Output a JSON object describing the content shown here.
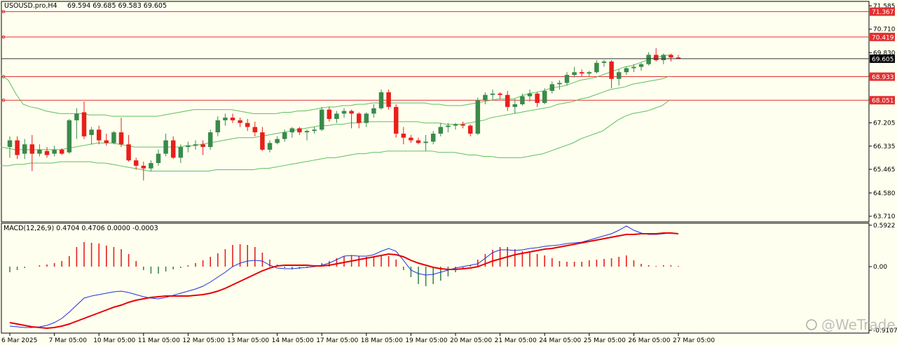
{
  "chart_data": {
    "type": "candlestick",
    "symbol_info": "USOUSD.pro,H4",
    "ohlc_info": "69.594 69.685 69.583 69.605",
    "colors": {
      "background": "#fffff0",
      "bull": "#3a8a4a",
      "bear": "#e8201a",
      "bands": "#5cc05c",
      "macd_line": "#2030e0",
      "signal_line": "#e80000",
      "level": "#e03030"
    },
    "price_axis": {
      "ticks": [
        "71.585",
        "70.710",
        "69.830",
        "68.960",
        "68.075",
        "67.205",
        "66.335",
        "65.465",
        "64.580",
        "63.710"
      ],
      "ylim": [
        63.5,
        71.75
      ]
    },
    "levels": [
      {
        "value": 71.367,
        "label": "71.367"
      },
      {
        "value": 70.419,
        "label": "70.419"
      },
      {
        "value": 68.933,
        "label": "68.933"
      },
      {
        "value": 68.051,
        "label": "68.051"
      }
    ],
    "current_price": {
      "value": 69.605,
      "label": "69.605"
    },
    "candles": [
      {
        "o": 66.3,
        "h": 66.7,
        "l": 65.9,
        "c": 66.55
      },
      {
        "o": 66.55,
        "h": 66.7,
        "l": 65.85,
        "c": 66.0
      },
      {
        "o": 66.05,
        "h": 66.6,
        "l": 65.85,
        "c": 66.4
      },
      {
        "o": 66.4,
        "h": 66.75,
        "l": 65.4,
        "c": 66.05
      },
      {
        "o": 66.05,
        "h": 66.4,
        "l": 65.95,
        "c": 66.2
      },
      {
        "o": 66.15,
        "h": 66.3,
        "l": 65.9,
        "c": 66.0
      },
      {
        "o": 66.05,
        "h": 66.35,
        "l": 65.95,
        "c": 66.2
      },
      {
        "o": 66.2,
        "h": 66.25,
        "l": 66.0,
        "c": 66.05
      },
      {
        "o": 66.1,
        "h": 67.35,
        "l": 66.05,
        "c": 67.3
      },
      {
        "o": 67.3,
        "h": 67.75,
        "l": 66.6,
        "c": 67.55
      },
      {
        "o": 67.6,
        "h": 68.0,
        "l": 66.6,
        "c": 66.7
      },
      {
        "o": 66.75,
        "h": 67.05,
        "l": 66.4,
        "c": 66.95
      },
      {
        "o": 66.95,
        "h": 67.1,
        "l": 66.4,
        "c": 66.55
      },
      {
        "o": 66.55,
        "h": 66.8,
        "l": 66.35,
        "c": 66.45
      },
      {
        "o": 66.45,
        "h": 66.9,
        "l": 66.4,
        "c": 66.85
      },
      {
        "o": 66.85,
        "h": 67.4,
        "l": 66.3,
        "c": 66.4
      },
      {
        "o": 66.4,
        "h": 66.75,
        "l": 65.75,
        "c": 65.8
      },
      {
        "o": 65.8,
        "h": 65.9,
        "l": 65.45,
        "c": 65.6
      },
      {
        "o": 65.6,
        "h": 65.75,
        "l": 65.05,
        "c": 65.5
      },
      {
        "o": 65.5,
        "h": 65.8,
        "l": 65.4,
        "c": 65.7
      },
      {
        "o": 65.7,
        "h": 66.2,
        "l": 65.6,
        "c": 66.05
      },
      {
        "o": 66.05,
        "h": 66.8,
        "l": 65.95,
        "c": 66.55
      },
      {
        "o": 66.55,
        "h": 66.7,
        "l": 65.85,
        "c": 65.9
      },
      {
        "o": 65.9,
        "h": 66.4,
        "l": 65.7,
        "c": 66.3
      },
      {
        "o": 66.3,
        "h": 66.5,
        "l": 66.1,
        "c": 66.35
      },
      {
        "o": 66.35,
        "h": 66.55,
        "l": 66.2,
        "c": 66.4
      },
      {
        "o": 66.4,
        "h": 66.55,
        "l": 66.0,
        "c": 66.3
      },
      {
        "o": 66.3,
        "h": 66.95,
        "l": 66.2,
        "c": 66.85
      },
      {
        "o": 66.85,
        "h": 67.45,
        "l": 66.7,
        "c": 67.3
      },
      {
        "o": 67.3,
        "h": 67.55,
        "l": 67.1,
        "c": 67.4
      },
      {
        "o": 67.4,
        "h": 67.55,
        "l": 67.2,
        "c": 67.3
      },
      {
        "o": 67.3,
        "h": 67.4,
        "l": 67.05,
        "c": 67.2
      },
      {
        "o": 67.2,
        "h": 67.35,
        "l": 66.9,
        "c": 67.05
      },
      {
        "o": 67.05,
        "h": 67.25,
        "l": 66.7,
        "c": 66.85
      },
      {
        "o": 66.85,
        "h": 67.05,
        "l": 66.15,
        "c": 66.2
      },
      {
        "o": 66.2,
        "h": 66.55,
        "l": 66.1,
        "c": 66.45
      },
      {
        "o": 66.45,
        "h": 66.7,
        "l": 66.4,
        "c": 66.6
      },
      {
        "o": 66.6,
        "h": 66.95,
        "l": 66.5,
        "c": 66.85
      },
      {
        "o": 66.85,
        "h": 67.05,
        "l": 66.65,
        "c": 67.0
      },
      {
        "o": 67.0,
        "h": 67.05,
        "l": 66.75,
        "c": 66.85
      },
      {
        "o": 66.85,
        "h": 66.95,
        "l": 66.55,
        "c": 66.9
      },
      {
        "o": 66.9,
        "h": 67.05,
        "l": 66.8,
        "c": 66.95
      },
      {
        "o": 66.95,
        "h": 67.8,
        "l": 66.9,
        "c": 67.7
      },
      {
        "o": 67.7,
        "h": 67.8,
        "l": 67.25,
        "c": 67.35
      },
      {
        "o": 67.35,
        "h": 67.65,
        "l": 67.2,
        "c": 67.55
      },
      {
        "o": 67.55,
        "h": 67.75,
        "l": 67.4,
        "c": 67.65
      },
      {
        "o": 67.65,
        "h": 67.7,
        "l": 67.0,
        "c": 67.55
      },
      {
        "o": 67.55,
        "h": 67.6,
        "l": 67.0,
        "c": 67.2
      },
      {
        "o": 67.2,
        "h": 67.6,
        "l": 67.05,
        "c": 67.55
      },
      {
        "o": 67.55,
        "h": 67.9,
        "l": 67.4,
        "c": 67.75
      },
      {
        "o": 67.75,
        "h": 68.45,
        "l": 67.7,
        "c": 68.35
      },
      {
        "o": 68.35,
        "h": 68.45,
        "l": 67.7,
        "c": 67.8
      },
      {
        "o": 67.8,
        "h": 67.9,
        "l": 66.65,
        "c": 66.8
      },
      {
        "o": 66.8,
        "h": 67.05,
        "l": 66.4,
        "c": 66.65
      },
      {
        "o": 66.65,
        "h": 66.75,
        "l": 66.45,
        "c": 66.55
      },
      {
        "o": 66.55,
        "h": 66.65,
        "l": 66.4,
        "c": 66.45
      },
      {
        "o": 66.45,
        "h": 66.75,
        "l": 66.15,
        "c": 66.5
      },
      {
        "o": 66.5,
        "h": 66.9,
        "l": 66.4,
        "c": 66.8
      },
      {
        "o": 66.8,
        "h": 67.2,
        "l": 66.7,
        "c": 67.05
      },
      {
        "o": 67.05,
        "h": 67.2,
        "l": 66.85,
        "c": 67.1
      },
      {
        "o": 67.1,
        "h": 67.2,
        "l": 66.95,
        "c": 67.15
      },
      {
        "o": 67.15,
        "h": 67.25,
        "l": 67.0,
        "c": 67.1
      },
      {
        "o": 67.1,
        "h": 67.15,
        "l": 66.7,
        "c": 66.8
      },
      {
        "o": 66.8,
        "h": 68.15,
        "l": 66.75,
        "c": 68.05
      },
      {
        "o": 68.05,
        "h": 68.35,
        "l": 67.9,
        "c": 68.25
      },
      {
        "o": 68.25,
        "h": 68.45,
        "l": 68.05,
        "c": 68.3
      },
      {
        "o": 68.3,
        "h": 68.35,
        "l": 68.1,
        "c": 68.25
      },
      {
        "o": 68.25,
        "h": 68.4,
        "l": 67.65,
        "c": 67.8
      },
      {
        "o": 67.8,
        "h": 68.1,
        "l": 67.55,
        "c": 67.9
      },
      {
        "o": 67.9,
        "h": 68.3,
        "l": 67.85,
        "c": 68.2
      },
      {
        "o": 68.2,
        "h": 68.45,
        "l": 68.0,
        "c": 68.3
      },
      {
        "o": 68.3,
        "h": 68.35,
        "l": 67.8,
        "c": 67.95
      },
      {
        "o": 67.95,
        "h": 68.5,
        "l": 67.9,
        "c": 68.4
      },
      {
        "o": 68.4,
        "h": 68.75,
        "l": 68.3,
        "c": 68.65
      },
      {
        "o": 68.65,
        "h": 68.8,
        "l": 68.45,
        "c": 68.7
      },
      {
        "o": 68.7,
        "h": 69.1,
        "l": 68.6,
        "c": 69.0
      },
      {
        "o": 69.0,
        "h": 69.3,
        "l": 68.9,
        "c": 69.1
      },
      {
        "o": 69.1,
        "h": 69.2,
        "l": 68.95,
        "c": 69.05
      },
      {
        "o": 69.05,
        "h": 69.15,
        "l": 68.95,
        "c": 69.1
      },
      {
        "o": 69.1,
        "h": 69.55,
        "l": 69.05,
        "c": 69.45
      },
      {
        "o": 69.45,
        "h": 69.55,
        "l": 69.3,
        "c": 69.5
      },
      {
        "o": 69.5,
        "h": 69.55,
        "l": 68.5,
        "c": 68.85
      },
      {
        "o": 68.85,
        "h": 69.2,
        "l": 68.6,
        "c": 69.1
      },
      {
        "o": 69.1,
        "h": 69.3,
        "l": 69.0,
        "c": 69.25
      },
      {
        "o": 69.25,
        "h": 69.4,
        "l": 69.1,
        "c": 69.3
      },
      {
        "o": 69.3,
        "h": 69.45,
        "l": 69.15,
        "c": 69.4
      },
      {
        "o": 69.4,
        "h": 69.85,
        "l": 69.35,
        "c": 69.75
      },
      {
        "o": 69.75,
        "h": 70.0,
        "l": 69.5,
        "c": 69.55
      },
      {
        "o": 69.55,
        "h": 69.8,
        "l": 69.4,
        "c": 69.75
      },
      {
        "o": 69.75,
        "h": 69.8,
        "l": 69.5,
        "c": 69.65
      },
      {
        "o": 69.65,
        "h": 69.75,
        "l": 69.6,
        "c": 69.6
      }
    ],
    "bollinger": {
      "upper": [
        69.0,
        68.8,
        68.3,
        67.9,
        67.8,
        67.75,
        67.65,
        67.6,
        67.55,
        67.55,
        67.55,
        67.55,
        67.5,
        67.5,
        67.5,
        67.45,
        67.45,
        67.45,
        67.45,
        67.45,
        67.45,
        67.45,
        67.5,
        67.55,
        67.6,
        67.65,
        67.7,
        67.7,
        67.7,
        67.7,
        67.7,
        67.7,
        67.65,
        67.6,
        67.55,
        67.55,
        67.55,
        67.55,
        67.6,
        67.6,
        67.65,
        67.65,
        67.7,
        67.75,
        67.8,
        67.8,
        67.85,
        67.85,
        67.9,
        67.9,
        67.95,
        67.95,
        67.95,
        67.95,
        67.95,
        67.95,
        67.95,
        67.95,
        67.9,
        67.9,
        67.85,
        67.85,
        67.85,
        67.9,
        67.95,
        68.0,
        68.05,
        68.1,
        68.1,
        68.1,
        68.2,
        68.3,
        68.35,
        68.4,
        68.5,
        68.55,
        68.6,
        68.7,
        68.8,
        68.85,
        68.9,
        69.0,
        69.1,
        69.2,
        69.3,
        69.35,
        69.45,
        69.55,
        69.65,
        69.7,
        69.75
      ],
      "middle": [
        66.3,
        66.25,
        66.2,
        66.2,
        66.2,
        66.2,
        66.2,
        66.2,
        66.2,
        66.25,
        66.3,
        66.35,
        66.4,
        66.45,
        66.45,
        66.45,
        66.4,
        66.35,
        66.3,
        66.3,
        66.3,
        66.3,
        66.3,
        66.3,
        66.3,
        66.35,
        66.35,
        66.4,
        66.45,
        66.5,
        66.55,
        66.6,
        66.65,
        66.65,
        66.65,
        66.7,
        66.75,
        66.8,
        66.85,
        66.9,
        66.95,
        67.0,
        67.05,
        67.1,
        67.1,
        67.15,
        67.15,
        67.2,
        67.2,
        67.25,
        67.25,
        67.25,
        67.25,
        67.25,
        67.25,
        67.25,
        67.25,
        67.2,
        67.2,
        67.2,
        67.15,
        67.15,
        67.15,
        67.2,
        67.25,
        67.3,
        67.4,
        67.45,
        67.5,
        67.55,
        67.6,
        67.65,
        67.7,
        67.75,
        67.8,
        67.9,
        67.95,
        68.0,
        68.1,
        68.15,
        68.25,
        68.35,
        68.45,
        68.5,
        68.55,
        68.65,
        68.7,
        68.75,
        68.8,
        68.85,
        68.95
      ],
      "lower": [
        65.6,
        65.6,
        65.65,
        65.65,
        65.7,
        65.7,
        65.7,
        65.7,
        65.75,
        65.75,
        65.75,
        65.75,
        65.75,
        65.7,
        65.7,
        65.65,
        65.6,
        65.55,
        65.5,
        65.45,
        65.4,
        65.4,
        65.4,
        65.4,
        65.4,
        65.4,
        65.4,
        65.4,
        65.4,
        65.45,
        65.45,
        65.45,
        65.45,
        65.45,
        65.45,
        65.5,
        65.5,
        65.55,
        65.6,
        65.65,
        65.7,
        65.75,
        65.8,
        65.85,
        65.9,
        65.9,
        65.95,
        66.0,
        66.05,
        66.05,
        66.1,
        66.1,
        66.15,
        66.15,
        66.15,
        66.15,
        66.15,
        66.15,
        66.15,
        66.1,
        66.1,
        66.1,
        66.05,
        66.0,
        66.0,
        65.95,
        65.95,
        65.9,
        65.9,
        65.9,
        65.9,
        65.95,
        66.0,
        66.05,
        66.15,
        66.25,
        66.35,
        66.45,
        66.6,
        66.7,
        66.8,
        66.9,
        67.1,
        67.3,
        67.45,
        67.55,
        67.6,
        67.65,
        67.75,
        67.85,
        68.05
      ]
    },
    "macd": {
      "info": "MACD(12,26,9) 0.4704 0.4706 0.0000 -0.0003",
      "ticks": [
        "0.5922",
        "0.00",
        "-0.9107"
      ],
      "ylim": [
        -0.95,
        0.62
      ],
      "histogram": [
        -0.08,
        -0.05,
        -0.02,
        0.0,
        0.02,
        0.03,
        0.05,
        0.08,
        0.15,
        0.28,
        0.35,
        0.34,
        0.33,
        0.3,
        0.28,
        0.25,
        0.18,
        0.08,
        -0.05,
        -0.1,
        -0.1,
        -0.07,
        -0.04,
        -0.02,
        0.02,
        0.05,
        0.09,
        0.14,
        0.19,
        0.25,
        0.31,
        0.32,
        0.31,
        0.28,
        0.2,
        0.1,
        0.03,
        -0.02,
        -0.04,
        -0.03,
        -0.02,
        0.02,
        0.05,
        0.08,
        0.12,
        0.15,
        0.16,
        0.15,
        0.14,
        0.14,
        0.15,
        0.15,
        0.1,
        -0.05,
        -0.15,
        -0.25,
        -0.28,
        -0.25,
        -0.2,
        -0.14,
        -0.08,
        -0.03,
        0.02,
        0.1,
        0.18,
        0.24,
        0.28,
        0.28,
        0.25,
        0.22,
        0.2,
        0.18,
        0.16,
        0.12,
        0.08,
        0.07,
        0.07,
        0.07,
        0.09,
        0.1,
        0.11,
        0.12,
        0.14,
        0.16,
        0.09,
        0.04,
        0.02,
        0.01,
        0.02,
        0.02,
        0.01
      ],
      "macd_line": [
        -0.85,
        -0.86,
        -0.87,
        -0.87,
        -0.86,
        -0.84,
        -0.8,
        -0.74,
        -0.65,
        -0.55,
        -0.45,
        -0.42,
        -0.4,
        -0.38,
        -0.36,
        -0.35,
        -0.37,
        -0.4,
        -0.43,
        -0.45,
        -0.46,
        -0.44,
        -0.41,
        -0.38,
        -0.35,
        -0.32,
        -0.28,
        -0.22,
        -0.15,
        -0.08,
        0.0,
        0.05,
        0.08,
        0.09,
        0.08,
        0.02,
        -0.02,
        -0.03,
        -0.03,
        -0.02,
        -0.01,
        0.0,
        0.02,
        0.05,
        0.1,
        0.15,
        0.16,
        0.15,
        0.15,
        0.17,
        0.22,
        0.26,
        0.22,
        0.09,
        -0.05,
        -0.1,
        -0.12,
        -0.11,
        -0.08,
        -0.05,
        -0.02,
        0.0,
        0.02,
        0.04,
        0.12,
        0.2,
        0.24,
        0.24,
        0.23,
        0.24,
        0.26,
        0.27,
        0.29,
        0.3,
        0.31,
        0.33,
        0.34,
        0.35,
        0.38,
        0.41,
        0.44,
        0.47,
        0.52,
        0.58,
        0.52,
        0.48,
        0.46,
        0.46,
        0.47,
        0.48,
        0.47
      ],
      "signal_line": [
        -0.8,
        -0.82,
        -0.84,
        -0.86,
        -0.87,
        -0.88,
        -0.87,
        -0.85,
        -0.82,
        -0.78,
        -0.74,
        -0.7,
        -0.66,
        -0.62,
        -0.58,
        -0.55,
        -0.51,
        -0.48,
        -0.46,
        -0.44,
        -0.43,
        -0.42,
        -0.42,
        -0.42,
        -0.42,
        -0.41,
        -0.4,
        -0.38,
        -0.35,
        -0.31,
        -0.26,
        -0.21,
        -0.16,
        -0.11,
        -0.06,
        -0.02,
        0.01,
        0.02,
        0.02,
        0.02,
        0.02,
        0.01,
        0.01,
        0.02,
        0.04,
        0.06,
        0.08,
        0.1,
        0.12,
        0.14,
        0.16,
        0.18,
        0.17,
        0.14,
        0.09,
        0.05,
        0.02,
        -0.01,
        -0.03,
        -0.04,
        -0.04,
        -0.03,
        -0.02,
        0.0,
        0.04,
        0.08,
        0.11,
        0.14,
        0.17,
        0.19,
        0.21,
        0.23,
        0.25,
        0.26,
        0.28,
        0.3,
        0.32,
        0.34,
        0.36,
        0.38,
        0.4,
        0.42,
        0.44,
        0.46,
        0.46,
        0.47,
        0.47,
        0.47,
        0.48,
        0.48,
        0.47
      ]
    },
    "time_axis": [
      {
        "index": 0,
        "label": "6 Mar 2025"
      },
      {
        "index": 6,
        "label": "7 Mar 05:00"
      },
      {
        "index": 12,
        "label": "10 Mar 05:00"
      },
      {
        "index": 18,
        "label": "11 Mar 05:00"
      },
      {
        "index": 24,
        "label": "12 Mar 05:00"
      },
      {
        "index": 30,
        "label": "13 Mar 05:00"
      },
      {
        "index": 36,
        "label": "14 Mar 05:00"
      },
      {
        "index": 42,
        "label": "17 Mar 05:00"
      },
      {
        "index": 48,
        "label": "18 Mar 05:00"
      },
      {
        "index": 54,
        "label": "19 Mar 05:00"
      },
      {
        "index": 60,
        "label": "20 Mar 05:00"
      },
      {
        "index": 66,
        "label": "21 Mar 05:00"
      },
      {
        "index": 72,
        "label": "24 Mar 05:00"
      },
      {
        "index": 78,
        "label": "25 Mar 05:00"
      },
      {
        "index": 84,
        "label": "26 Mar 05:00"
      },
      {
        "index": 90,
        "label": "27 Mar 05:00"
      }
    ],
    "watermark": "@WeTrade"
  }
}
